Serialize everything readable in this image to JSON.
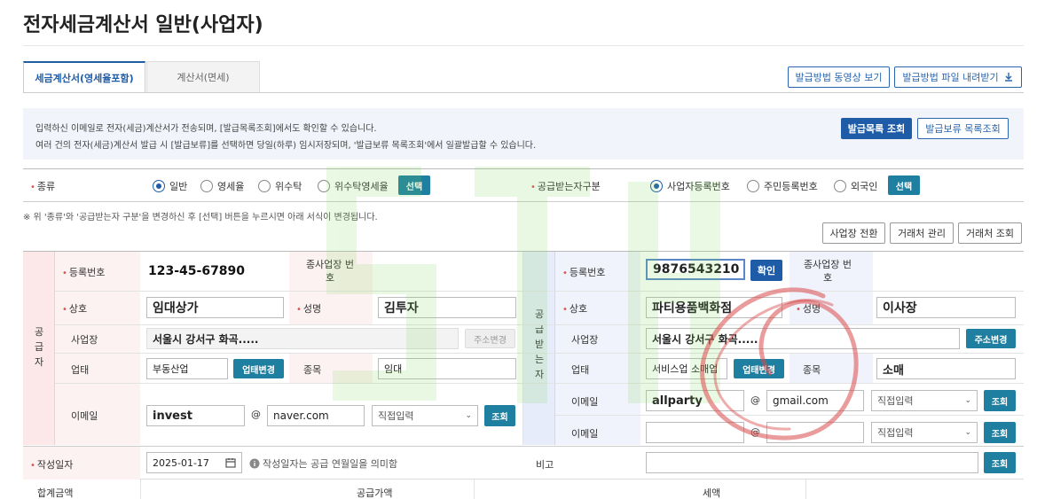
{
  "title": "전자세금계산서 일반(사업자)",
  "tabs": [
    {
      "label": "세금계산서(영세율포함)"
    },
    {
      "label": "계산서(면세)"
    }
  ],
  "top_buttons": {
    "video": "발급방법 동영상 보기",
    "download": "발급방법 파일 내려받기"
  },
  "notice": {
    "line1": "입력하신 이메일로 전자(세금)계산서가 전송되며, [발급목록조회]에서도 확인할 수 있습니다.",
    "line2": "여러 건의 전자(세금)계산서 발급 시 [발급보류]를 선택하면 당일(하루) 임시저장되며, '발급보류 목록조회'에서 일괄발급할 수 있습니다.",
    "btn_list": "발급목록 조회",
    "btn_hold": "발급보류 목록조회"
  },
  "kind": {
    "label": "종류",
    "options": [
      "일반",
      "영세율",
      "위수탁",
      "위수탁영세율"
    ],
    "selected": "일반",
    "select_btn": "선택"
  },
  "receiver_type": {
    "label": "공급받는자구분",
    "options": [
      "사업자등록번호",
      "주민등록번호",
      "외국인"
    ],
    "selected": "사업자등록번호",
    "select_btn": "선택"
  },
  "change_note": "※ 위 '종류'와 '공급받는자 구분'을 변경하신 후 [선택] 버튼을 누르시면 아래 서식이 변경됩니다.",
  "mid_buttons": {
    "switch": "사업장 전환",
    "manage": "거래처 관리",
    "lookup": "거래처 조회"
  },
  "supplier": {
    "side": [
      "공",
      "급",
      "자"
    ],
    "reg_label": "등록번호",
    "reg_value": "123-45-67890",
    "sub_label": "종사업장 번호",
    "name_label": "상호",
    "name_value": "임대상가",
    "ceo_label": "성명",
    "ceo_value": "김투자",
    "addr_label": "사업장",
    "addr_value": "서울시 강서구 화곡.....",
    "addr_btn": "주소변경",
    "biz_label": "업태",
    "biz_value": "부동산업",
    "biz_btn": "업태변경",
    "item_label": "종목",
    "item_value": "임대",
    "email_label": "이메일",
    "email_id": "invest",
    "email_at": "@",
    "email_domain": "naver.com",
    "email_select": "직접입력",
    "email_btn": "조회"
  },
  "receiver": {
    "side": [
      "공",
      "급",
      "받",
      "는",
      "자"
    ],
    "reg_label": "등록번호",
    "reg_value": "9876543210",
    "reg_btn": "확인",
    "sub_label": "종사업장 번호",
    "name_label": "상호",
    "name_value": "파티용품백화점",
    "ceo_label": "성명",
    "ceo_value": "이사장",
    "addr_label": "사업장",
    "addr_value": "서울시 강서구 화곡.....",
    "addr_btn": "주소변경",
    "biz_label": "업태",
    "biz_value": "서비스업 소매업",
    "biz_btn": "업태변경",
    "item_label": "종목",
    "item_value": "소매",
    "email1_label": "이메일",
    "email1_id": "allparty",
    "email1_at": "@",
    "email1_domain": "gmail.com",
    "email1_select": "직접입력",
    "email1_btn": "조회",
    "email2_label": "이메일",
    "email2_at": "@",
    "email2_select": "직접입력",
    "email2_btn": "조회"
  },
  "date": {
    "label": "작성일자",
    "value": "2025-01-17",
    "hint": "작성일자는 공급 연월일을 의미함"
  },
  "remark": {
    "label": "비고",
    "btn": "조회"
  },
  "sums": {
    "total": "합계금액",
    "supply": "공급가액",
    "tax": "세액"
  },
  "colors": {
    "accent": "#1e5ca8",
    "teal": "#1e7fa0",
    "supplier_bg": "#fce8e8",
    "receiver_bg": "#e6ecfa",
    "required": "#d9534f"
  },
  "icons": [
    "calendar-icon",
    "info-icon",
    "download-icon",
    "chevron-down-icon"
  ]
}
